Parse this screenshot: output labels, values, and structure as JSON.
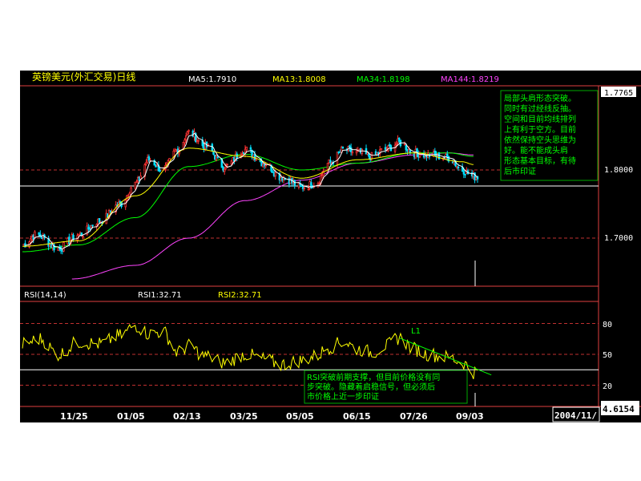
{
  "header": {
    "title": "英镑美元(外汇交易)日线",
    "ma_labels": [
      {
        "text": "MA5:1.7910",
        "color": "#ffffff"
      },
      {
        "text": "MA13:1.8008",
        "color": "#ffff00"
      },
      {
        "text": "MA34:1.8198",
        "color": "#00ff00"
      },
      {
        "text": "MA144:1.8219",
        "color": "#ff44ff"
      }
    ]
  },
  "rsi_header": {
    "name": "RSI(14,14)",
    "rsi1": "RSI1:32.71",
    "rsi2": "RSI2:32.71"
  },
  "annotations": {
    "top_note": [
      "局部头肩形态突破。",
      "同时有过经线反抽。",
      "空间和目前均线排列",
      "上有利于空方。目前",
      "依然保持空头思维为",
      "好。能不能成头肩",
      "形态基本目标，有待",
      "后市印证"
    ],
    "bottom_note": [
      "RSI突破前期支撑，但目前价格没有同",
      "步突破。隐藏着启稳信号，但必须后",
      "市价格上近一步印证"
    ],
    "trendline_label": "L1"
  },
  "colors": {
    "background": "#000000",
    "up_candle": "#ff3333",
    "down_candle": "#00e0ff",
    "ma5": "#ffffff",
    "ma13": "#ffff00",
    "ma34": "#00ff00",
    "ma144": "#ff44ff",
    "rsi": "#ffff00",
    "frame": "#e04040",
    "axis_text": "#ffffff",
    "annotation_text": "#00ff00"
  },
  "chart_data": {
    "type": "candlestick",
    "price_axis": {
      "ticks": [
        1.7765,
        1.8,
        1.7
      ],
      "tick_labels": [
        "1.7765",
        "1.8000",
        "1.7000"
      ],
      "range": [
        1.62,
        1.82
      ]
    },
    "rsi_axis": {
      "ticks": [
        80,
        50,
        20
      ],
      "tick_labels": [
        "80",
        "50",
        "20"
      ],
      "range": [
        0,
        100
      ]
    },
    "x_axis": {
      "tick_labels": [
        "11/25",
        "01/05",
        "02/13",
        "03/25",
        "05/05",
        "06/15",
        "07/26",
        "09/03"
      ],
      "end_label": "2004/11/",
      "start_date": "2003-10-15",
      "end_date": "2004-09-10"
    },
    "current_price_box": "4.6154",
    "price_keypoints": [
      [
        "2003-10-15",
        1.69
      ],
      [
        "2003-10-25",
        1.705
      ],
      [
        "2003-11-10",
        1.685
      ],
      [
        "2003-11-25",
        1.705
      ],
      [
        "2003-12-10",
        1.725
      ],
      [
        "2003-12-25",
        1.75
      ],
      [
        "2004-01-05",
        1.78
      ],
      [
        "2004-01-15",
        1.815
      ],
      [
        "2004-01-25",
        1.8
      ],
      [
        "2004-02-05",
        1.83
      ],
      [
        "2004-02-13",
        1.855
      ],
      [
        "2004-02-25",
        1.835
      ],
      [
        "2004-03-10",
        1.805
      ],
      [
        "2004-03-25",
        1.83
      ],
      [
        "2004-04-08",
        1.81
      ],
      [
        "2004-04-20",
        1.79
      ],
      [
        "2004-05-05",
        1.775
      ],
      [
        "2004-05-15",
        1.78
      ],
      [
        "2004-05-25",
        1.81
      ],
      [
        "2004-06-05",
        1.83
      ],
      [
        "2004-06-15",
        1.825
      ],
      [
        "2004-06-25",
        1.82
      ],
      [
        "2004-07-05",
        1.83
      ],
      [
        "2004-07-15",
        1.84
      ],
      [
        "2004-07-26",
        1.825
      ],
      [
        "2004-08-05",
        1.822
      ],
      [
        "2004-08-20",
        1.818
      ],
      [
        "2004-08-30",
        1.8
      ],
      [
        "2004-09-07",
        1.79
      ]
    ],
    "ma13_keypoints": [
      [
        "2003-10-15",
        1.688
      ],
      [
        "2003-11-25",
        1.696
      ],
      [
        "2004-01-05",
        1.762
      ],
      [
        "2004-02-13",
        1.832
      ],
      [
        "2004-03-25",
        1.82
      ],
      [
        "2004-05-05",
        1.788
      ],
      [
        "2004-06-15",
        1.815
      ],
      [
        "2004-07-26",
        1.825
      ],
      [
        "2004-08-30",
        1.812
      ],
      [
        "2004-09-07",
        1.808
      ]
    ],
    "ma34_keypoints": [
      [
        "2003-10-15",
        1.68
      ],
      [
        "2003-11-25",
        1.69
      ],
      [
        "2004-01-05",
        1.73
      ],
      [
        "2004-02-13",
        1.805
      ],
      [
        "2004-03-25",
        1.823
      ],
      [
        "2004-05-05",
        1.8
      ],
      [
        "2004-06-15",
        1.81
      ],
      [
        "2004-07-26",
        1.825
      ],
      [
        "2004-08-20",
        1.825
      ],
      [
        "2004-09-07",
        1.82
      ]
    ],
    "ma144_keypoints": [
      [
        "2003-11-20",
        1.64
      ],
      [
        "2004-01-05",
        1.66
      ],
      [
        "2004-02-13",
        1.7
      ],
      [
        "2004-03-25",
        1.755
      ],
      [
        "2004-05-05",
        1.785
      ],
      [
        "2004-06-15",
        1.81
      ],
      [
        "2004-07-26",
        1.822
      ],
      [
        "2004-08-20",
        1.825
      ],
      [
        "2004-09-07",
        1.822
      ]
    ],
    "rsi_keypoints": [
      [
        "2003-10-15",
        60
      ],
      [
        "2003-10-28",
        65
      ],
      [
        "2003-11-10",
        50
      ],
      [
        "2003-11-25",
        62
      ],
      [
        "2003-12-10",
        60
      ],
      [
        "2003-12-25",
        68
      ],
      [
        "2004-01-05",
        78
      ],
      [
        "2004-01-15",
        70
      ],
      [
        "2004-01-25",
        72
      ],
      [
        "2004-02-05",
        52
      ],
      [
        "2004-02-13",
        58
      ],
      [
        "2004-02-25",
        48
      ],
      [
        "2004-03-10",
        42
      ],
      [
        "2004-03-25",
        50
      ],
      [
        "2004-04-08",
        45
      ],
      [
        "2004-04-20",
        40
      ],
      [
        "2004-05-05",
        44
      ],
      [
        "2004-05-15",
        48
      ],
      [
        "2004-05-25",
        57
      ],
      [
        "2004-06-05",
        62
      ],
      [
        "2004-06-15",
        55
      ],
      [
        "2004-06-25",
        52
      ],
      [
        "2004-07-05",
        58
      ],
      [
        "2004-07-15",
        66
      ],
      [
        "2004-07-26",
        55
      ],
      [
        "2004-08-05",
        50
      ],
      [
        "2004-08-20",
        47
      ],
      [
        "2004-08-30",
        42
      ],
      [
        "2004-09-07",
        32.71
      ]
    ],
    "trendline_L1": [
      [
        "2004-07-15",
        66
      ],
      [
        "2004-09-20",
        30
      ]
    ],
    "price_levels": {
      "white_line": 1.7765,
      "dashed_red": 1.8,
      "dashed_red_low": 1.7
    },
    "rsi_levels": {
      "white_line": 35,
      "dashed": [
        80,
        50,
        20
      ]
    }
  }
}
